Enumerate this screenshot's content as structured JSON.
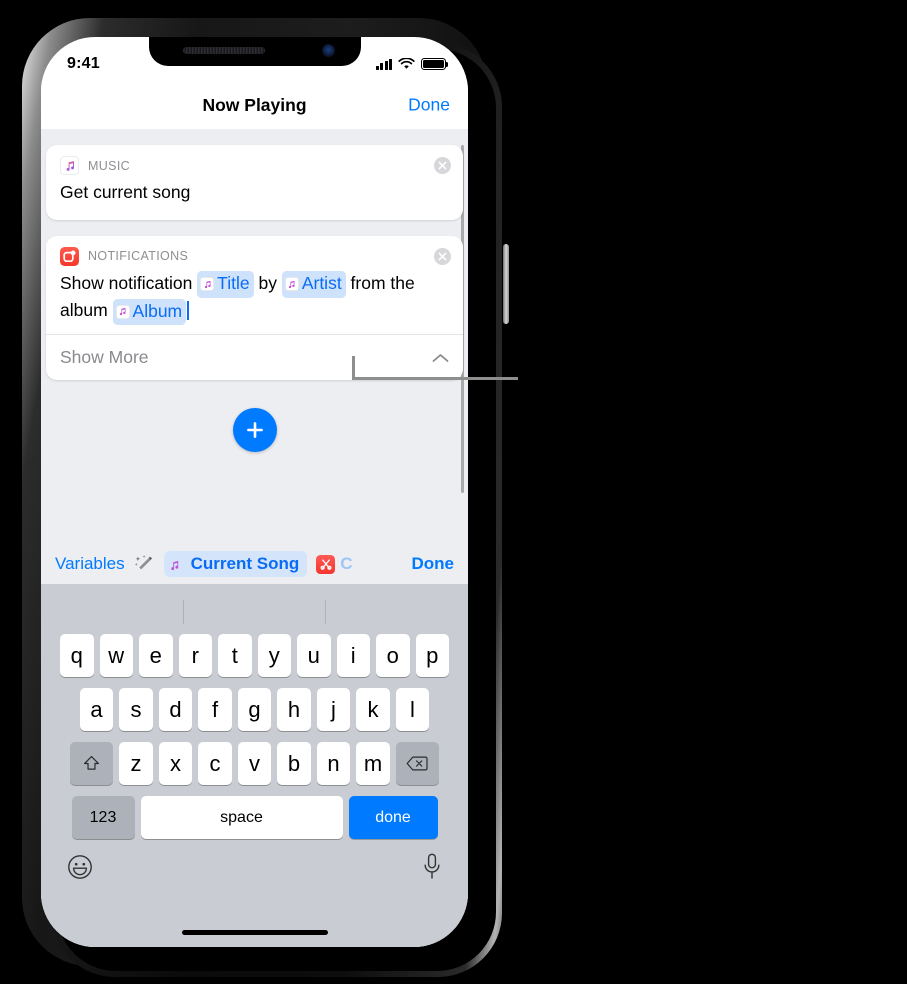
{
  "status_bar": {
    "time": "9:41",
    "signal_icon": "cellular-signal-icon",
    "wifi_icon": "wifi-icon",
    "battery_icon": "battery-full-icon"
  },
  "nav": {
    "title": "Now Playing",
    "done_label": "Done"
  },
  "actions": [
    {
      "app": "MUSIC",
      "app_icon": "apple-music-icon",
      "title": "Get current song",
      "remove_icon": "close-circle-icon"
    },
    {
      "app": "NOTIFICATIONS",
      "app_icon": "notifications-icon",
      "remove_icon": "close-circle-icon",
      "text_parts": [
        {
          "type": "text",
          "value": "Show notification "
        },
        {
          "type": "token",
          "value": "Title",
          "icon": "music-note-icon"
        },
        {
          "type": "text",
          "value": " by "
        },
        {
          "type": "token",
          "value": "Artist",
          "icon": "music-note-icon"
        },
        {
          "type": "text",
          "value": " from the album "
        },
        {
          "type": "token",
          "value": "Album",
          "icon": "music-note-icon"
        }
      ],
      "show_more_label": "Show More",
      "show_more_icon": "chevron-up-icon"
    }
  ],
  "add_action": {
    "icon": "plus-icon",
    "label": "Add Action"
  },
  "accessory_bar": {
    "variables_label": "Variables",
    "magic_icon": "magic-wand-icon",
    "tokens": [
      {
        "label": "Current Song",
        "icon": "music-note-icon"
      },
      {
        "label": "C",
        "icon": "shortcuts-icon"
      }
    ],
    "done_label": "Done"
  },
  "keyboard": {
    "row1": [
      "q",
      "w",
      "e",
      "r",
      "t",
      "y",
      "u",
      "i",
      "o",
      "p"
    ],
    "row2": [
      "a",
      "s",
      "d",
      "f",
      "g",
      "h",
      "j",
      "k",
      "l"
    ],
    "row3_letters": [
      "z",
      "x",
      "c",
      "v",
      "b",
      "n",
      "m"
    ],
    "shift_icon": "shift-icon",
    "backspace_icon": "backspace-icon",
    "numbers_label": "123",
    "space_label": "space",
    "return_label": "done",
    "emoji_icon": "emoji-icon",
    "dictation_icon": "microphone-icon"
  },
  "colors": {
    "accent_blue": "#007aff",
    "token_blue_text": "#0a6cf5",
    "token_blue_bg": "#cfe2fb",
    "notification_red": "#f5372b",
    "screen_bg": "#eceef1",
    "keyboard_bg": "#c9ccd2"
  }
}
